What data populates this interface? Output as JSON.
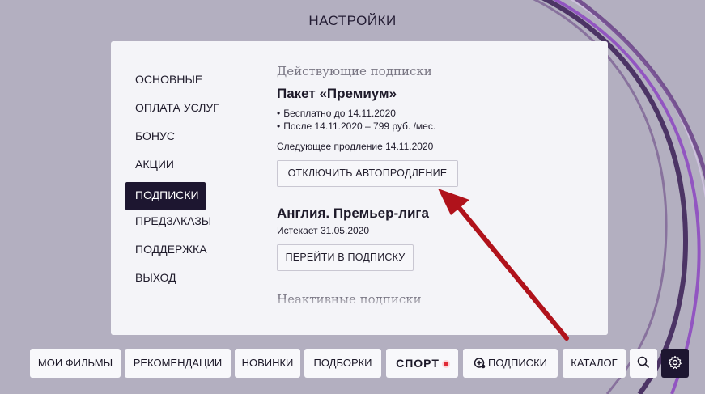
{
  "page": {
    "title": "НАСТРОЙКИ"
  },
  "menu": {
    "items": [
      {
        "label": "ОСНОВНЫЕ"
      },
      {
        "label": "ОПЛАТА УСЛУГ"
      },
      {
        "label": "БОНУС"
      },
      {
        "label": "АКЦИИ"
      },
      {
        "label": "ПОДПИСКИ",
        "active": true
      },
      {
        "label": "ПРЕДЗАКАЗЫ"
      },
      {
        "label": "ПОДДЕРЖКА"
      },
      {
        "label": "ВЫХОД"
      }
    ]
  },
  "subscriptions": {
    "active_title": "Действующие подписки",
    "premium": {
      "title": "Пакет «Премиум»",
      "bullets": [
        "Бесплатно до 14.11.2020",
        "После 14.11.2020 – 799 руб. /мес."
      ],
      "renewal": "Следующее продление 14.11.2020",
      "disable_button": "ОТКЛЮЧИТЬ АВТОПРОДЛЕНИЕ"
    },
    "league": {
      "title": "Англия. Премьер-лига",
      "expires": "Истекает 31.05.2020",
      "goto_button": "ПЕРЕЙТИ В ПОДПИСКУ"
    },
    "inactive_title": "Неактивные подписки"
  },
  "bottom_nav": {
    "my_films": "МОИ ФИЛЬМЫ",
    "recommendations": "РЕКОМЕНДАЦИИ",
    "new": "НОВИНКИ",
    "collections": "ПОДБОРКИ",
    "sport": "СПОРТ",
    "subscriptions": "ПОДПИСКИ",
    "catalog": "КАТАЛОГ",
    "icons": {
      "search": "search-icon",
      "settings": "gear-icon",
      "subscriptions": "plus-circle-icon"
    }
  },
  "colors": {
    "accent_dark": "#1d1630",
    "arrow_red": "#b0121b",
    "background": "#b3afc0"
  }
}
